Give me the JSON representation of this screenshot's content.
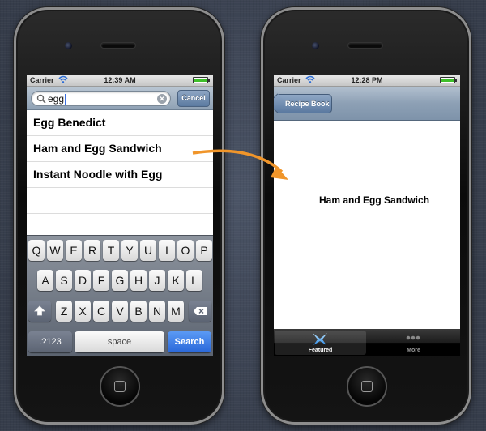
{
  "left_phone": {
    "status_bar": {
      "carrier": "Carrier",
      "time": "12:39 AM",
      "battery_level": 1.0
    },
    "search": {
      "query": "egg",
      "cancel_label": "Cancel"
    },
    "results": [
      {
        "label": "Egg Benedict"
      },
      {
        "label": "Ham and Egg Sandwich"
      },
      {
        "label": "Instant Noodle with Egg"
      }
    ],
    "keyboard": {
      "row1": [
        "Q",
        "W",
        "E",
        "R",
        "T",
        "Y",
        "U",
        "I",
        "O",
        "P"
      ],
      "row2": [
        "A",
        "S",
        "D",
        "F",
        "G",
        "H",
        "J",
        "K",
        "L"
      ],
      "row3": [
        "Z",
        "X",
        "C",
        "V",
        "B",
        "N",
        "M"
      ],
      "numbers_label": ".?123",
      "space_label": "space",
      "search_label": "Search",
      "shift_icon": "shift-icon",
      "delete_icon": "backspace-icon"
    }
  },
  "right_phone": {
    "status_bar": {
      "carrier": "Carrier",
      "time": "12:28 PM",
      "battery_level": 1.0
    },
    "nav": {
      "back_label": "Recipe Book"
    },
    "detail_title": "Ham and Egg Sandwich",
    "tabs": [
      {
        "label": "Featured",
        "icon": "star-icon",
        "active": true
      },
      {
        "label": "More",
        "icon": "more-dots-icon",
        "active": false
      }
    ]
  },
  "colors": {
    "arrow": "#f0952a",
    "search_key": "#2a68d9",
    "battery": "#3fbf2a"
  }
}
